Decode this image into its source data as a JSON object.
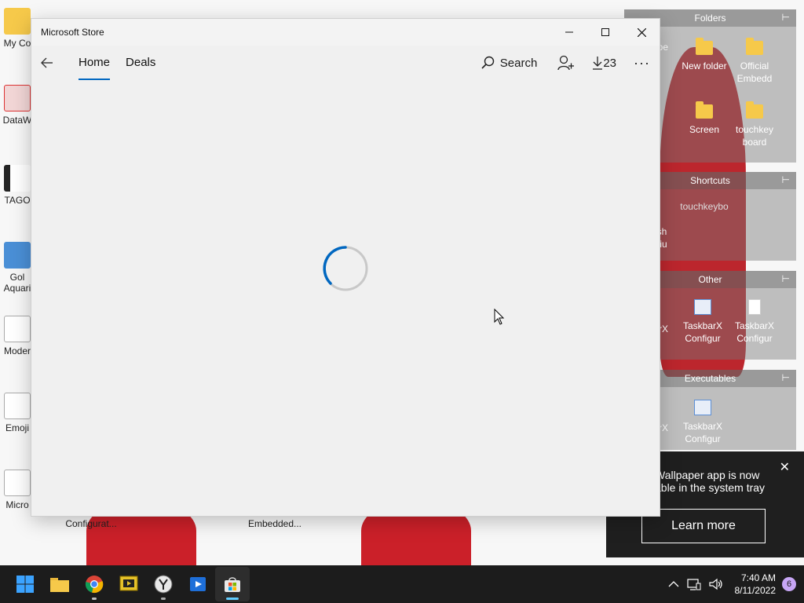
{
  "window": {
    "title": "Microsoft Store",
    "minimize_label": "Minimize",
    "maximize_label": "Maximize",
    "close_label": "Close"
  },
  "nav": {
    "tabs": [
      {
        "label": "Home",
        "active": true
      },
      {
        "label": "Deals",
        "active": false
      }
    ],
    "search_label": "Search",
    "downloads_count": "23",
    "more_label": "···"
  },
  "desktop": {
    "icons": [
      {
        "label": "My Co"
      },
      {
        "label": "DataW"
      },
      {
        "label": "TAGO"
      },
      {
        "label": "Gol Aquari"
      },
      {
        "label": "Moder"
      },
      {
        "label": "Emoji"
      },
      {
        "label": "Micro"
      },
      {
        "label": "Configurat..."
      },
      {
        "label": "Embedded..."
      }
    ]
  },
  "fences": [
    {
      "title": "Folders",
      "items": [
        {
          "label": "ape",
          "kind": "folder"
        },
        {
          "label": "New folder",
          "kind": "folder"
        },
        {
          "label": "Official Embedd",
          "kind": "folder"
        },
        {
          "label": "Screen",
          "kind": "folder"
        },
        {
          "label": "touchkey board",
          "kind": "folder"
        }
      ]
    },
    {
      "title": "Shortcuts",
      "items": [
        {
          "label": "touchkeybo",
          "kind": "folder"
        },
        {
          "label": "sh riu",
          "kind": "file"
        }
      ]
    },
    {
      "title": "Other",
      "items": [
        {
          "label": "rX",
          "kind": "app"
        },
        {
          "label": "TaskbarX Configur",
          "kind": "app"
        },
        {
          "label": "TaskbarX Configur",
          "kind": "file"
        }
      ]
    },
    {
      "title": "Executables",
      "items": [
        {
          "label": "rX",
          "kind": "app"
        },
        {
          "label": "TaskbarX Configur",
          "kind": "app"
        }
      ]
    }
  ],
  "toast": {
    "message_line1": "Wallpaper app is now",
    "message_line2": "able in the system tray",
    "button_label": "Learn more"
  },
  "taskbar": {
    "apps": [
      {
        "name": "start-button",
        "icon": "windows-logo-icon"
      },
      {
        "name": "file-explorer",
        "icon": "folder-icon"
      },
      {
        "name": "chrome",
        "icon": "chrome-icon"
      },
      {
        "name": "media-app",
        "icon": "slideshow-icon"
      },
      {
        "name": "yandex-browser",
        "icon": "y-browser-icon"
      },
      {
        "name": "video-app",
        "icon": "film-play-icon"
      },
      {
        "name": "microsoft-store",
        "icon": "store-bag-icon",
        "active": true
      }
    ],
    "time": "7:40 AM",
    "date": "8/11/2022",
    "notification_count": "6"
  },
  "colors": {
    "accent": "#0067c0",
    "taskbar": "#1c1c1c",
    "window_bg": "#f0f0f0",
    "badge": "#c7a6f5"
  }
}
